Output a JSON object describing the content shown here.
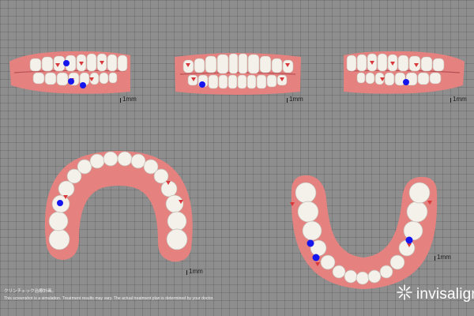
{
  "views": [
    {
      "name": "right-lateral-view",
      "scale_label": "1mm",
      "attachment_markers": 3
    },
    {
      "name": "frontal-view",
      "scale_label": "1mm",
      "attachment_markers": 1
    },
    {
      "name": "left-lateral-view",
      "scale_label": "1mm",
      "attachment_markers": 1
    },
    {
      "name": "upper-occlusal-view",
      "scale_label": "1mm",
      "attachment_markers": 1
    },
    {
      "name": "lower-occlusal-view",
      "scale_label": "1mm",
      "attachment_markers": 3
    }
  ],
  "footer": {
    "title": "クリンチェック治療計画。",
    "disclaimer": "This screenshot is a simulation. Treatment results may vary. The actual treatment plan is determined by your doctor."
  },
  "brand": {
    "name": "invisalign",
    "icon": "invisalign-star-icon"
  },
  "colors": {
    "background": "#8e8e8e",
    "gum": "#e5817f",
    "tooth": "#f3f1ea",
    "marker": "#1515ee",
    "attachment": "#d9383a"
  }
}
